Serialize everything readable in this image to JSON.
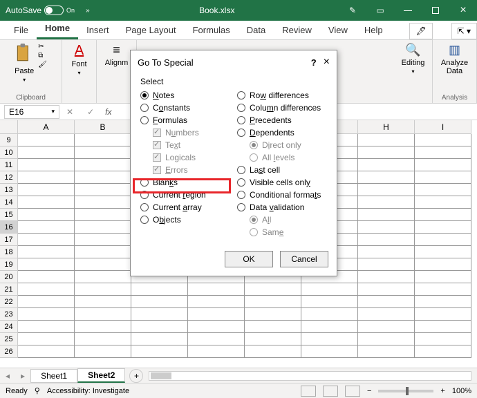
{
  "titlebar": {
    "autosave_label": "AutoSave",
    "autosave_state": "On",
    "filename": "Book.xlsx"
  },
  "tabs": {
    "file": "File",
    "home": "Home",
    "insert": "Insert",
    "pagelayout": "Page Layout",
    "formulas": "Formulas",
    "data": "Data",
    "review": "Review",
    "view": "View",
    "help": "Help"
  },
  "ribbon": {
    "paste": "Paste",
    "clipboard": "Clipboard",
    "font": "Font",
    "alignment": "Alignm",
    "editing": "Editing",
    "analyze": "Analyze\nData",
    "analysis": "Analysis"
  },
  "namebox": {
    "value": "E16"
  },
  "columns": [
    "A",
    "B",
    "",
    "",
    "",
    "",
    "H",
    "I"
  ],
  "rows_vis": [
    "9",
    "10",
    "11",
    "12",
    "13",
    "14",
    "15",
    "16",
    "17",
    "18",
    "19",
    "20",
    "21",
    "22",
    "23",
    "24",
    "25",
    "26"
  ],
  "row_selected": "16",
  "sheets": {
    "s1": "Sheet1",
    "s2": "Sheet2"
  },
  "status": {
    "ready": "Ready",
    "acc": "Accessibility: Investigate",
    "zoom": "100%"
  },
  "dialog": {
    "title": "Go To Special",
    "select": "Select",
    "left": {
      "notes": "Notes",
      "constants": "Constants",
      "formulas": "Formulas",
      "numbers": "Numbers",
      "text": "Text",
      "logicals": "Logicals",
      "errors": "Errors",
      "blanks": "Blanks",
      "current_region": "Current region",
      "current_array": "Current array",
      "objects": "Objects"
    },
    "right": {
      "row_diff": "Row differences",
      "col_diff": "Column differences",
      "precedents": "Precedents",
      "dependents": "Dependents",
      "direct_only": "Direct only",
      "all_levels": "All levels",
      "last_cell": "Last cell",
      "visible_cells": "Visible cells only",
      "cond_formats": "Conditional formats",
      "data_validation": "Data validation",
      "all": "All",
      "same": "Same"
    },
    "ok": "OK",
    "cancel": "Cancel"
  }
}
